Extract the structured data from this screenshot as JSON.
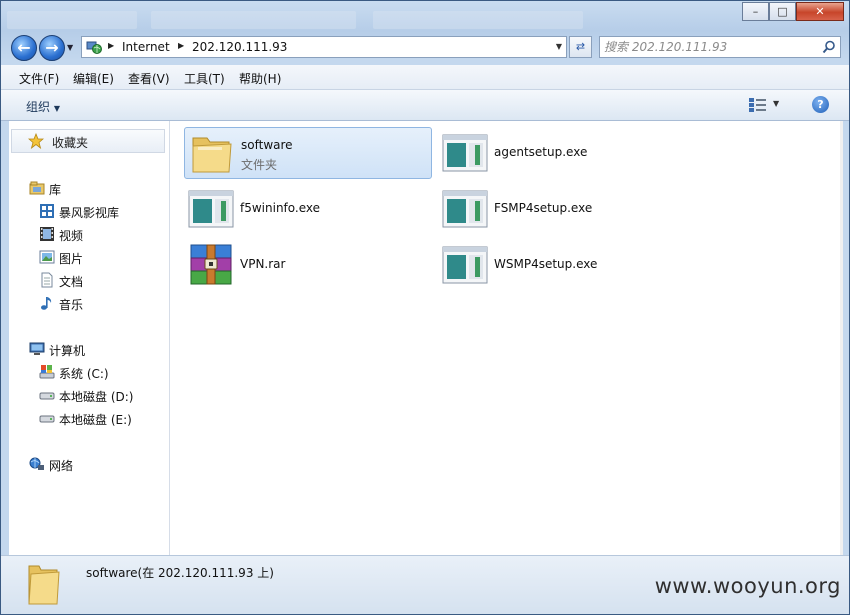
{
  "window": {
    "title": ""
  },
  "navigation": {
    "breadcrumbs": [
      "Internet",
      "202.120.111.93"
    ],
    "search_placeholder": "搜索 202.120.111.93"
  },
  "menu": {
    "items": [
      "文件(F)",
      "编辑(E)",
      "查看(V)",
      "工具(T)",
      "帮助(H)"
    ]
  },
  "toolbar": {
    "organize_label": "组织"
  },
  "sidebar": {
    "favorites": "收藏夹",
    "library": "库",
    "library_items": [
      "暴风影视库",
      "视频",
      "图片",
      "文档",
      "音乐"
    ],
    "computer": "计算机",
    "drives": [
      "系统 (C:)",
      "本地磁盘 (D:)",
      "本地磁盘 (E:)"
    ],
    "network": "网络"
  },
  "files": [
    {
      "name": "software",
      "type": "文件夹",
      "icon": "folder-icon",
      "selected": true
    },
    {
      "name": "agentsetup.exe",
      "type": "",
      "icon": "exe-icon"
    },
    {
      "name": "f5wininfo.exe",
      "type": "",
      "icon": "exe-icon"
    },
    {
      "name": "FSMP4setup.exe",
      "type": "",
      "icon": "exe-icon"
    },
    {
      "name": "VPN.rar",
      "type": "",
      "icon": "rar-icon"
    },
    {
      "name": "WSMP4setup.exe",
      "type": "",
      "icon": "exe-icon"
    }
  ],
  "details": {
    "text": "software(在 202.120.111.93 上)"
  },
  "watermark": "www.wooyun.org",
  "colors": {
    "selection": "#cfe2f7",
    "accent": "#2a6fd0"
  }
}
